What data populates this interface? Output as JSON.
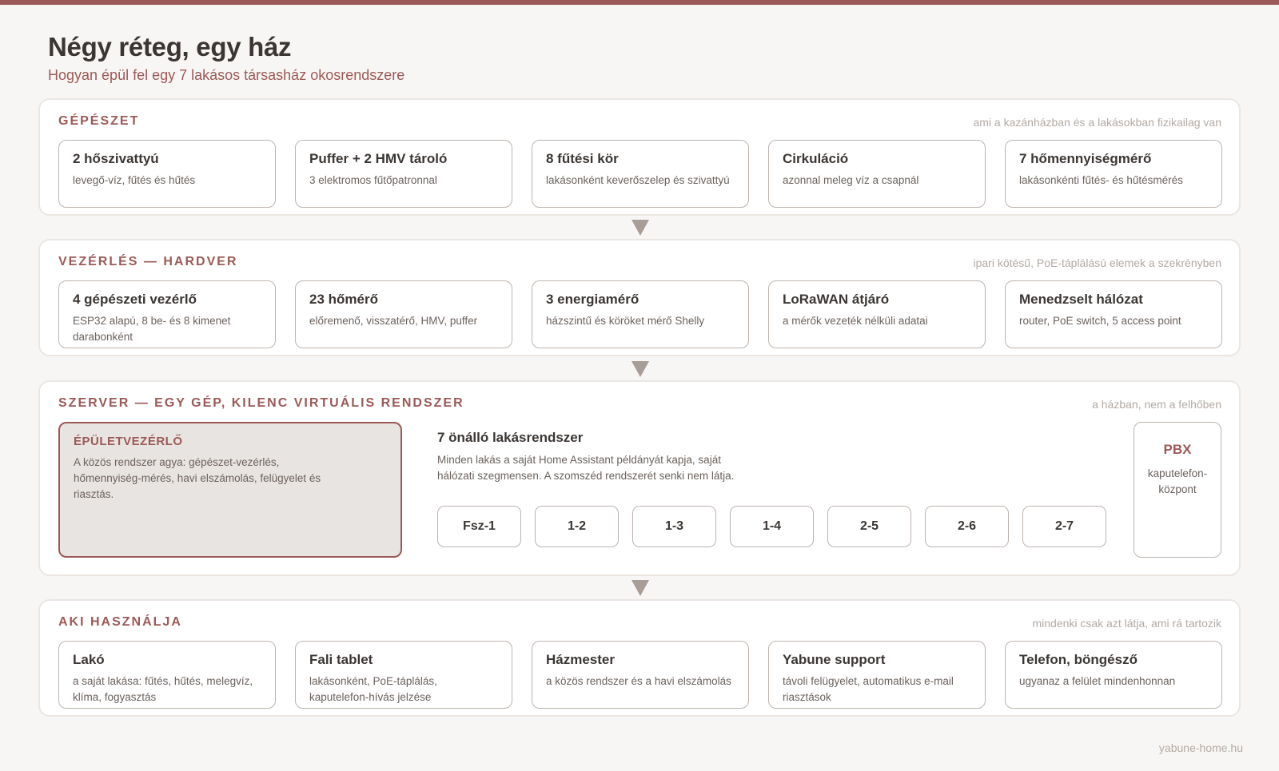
{
  "header": {
    "title": "Négy réteg, egy ház",
    "subtitle": "Hogyan épül fel egy 7 lakásos társasház okosrendszere"
  },
  "layers": [
    {
      "title": "GÉPÉSZET",
      "note": "ami a kazánházban és a lakásokban fizikailag van",
      "cards": [
        {
          "title": "2 hőszivattyú",
          "desc": "levegő-víz, fűtés és hűtés"
        },
        {
          "title": "Puffer + 2 HMV tároló",
          "desc": "3 elektromos fűtőpatronnal"
        },
        {
          "title": "8 fűtési kör",
          "desc": "lakásonként keverőszelep és szivattyú"
        },
        {
          "title": "Cirkuláció",
          "desc": "azonnal meleg víz a csapnál"
        },
        {
          "title": "7 hőmennyiségmérő",
          "desc": "lakásonkénti fűtés- és hűtésmérés"
        }
      ]
    },
    {
      "title": "VEZÉRLÉS — HARDVER",
      "note": "ipari kötésű, PoE-táplálású elemek a szekrényben",
      "cards": [
        {
          "title": "4 gépészeti vezérlő",
          "desc": "ESP32 alapú, 8 be- és 8 kimenet darabonként"
        },
        {
          "title": "23 hőmérő",
          "desc": "előremenő, visszatérő, HMV, puffer"
        },
        {
          "title": "3 energiamérő",
          "desc": "házszintű és köröket mérő Shelly"
        },
        {
          "title": "LoRaWAN átjáró",
          "desc": "a mérők vezeték nélküli adatai"
        },
        {
          "title": "Menedzselt hálózat",
          "desc": "router, PoE switch, 5 access point"
        }
      ]
    },
    {
      "title": "SZERVER — EGY GÉP, KILENC VIRTUÁLIS RENDSZER",
      "note": "a házban, nem a felhőben",
      "building": {
        "title": "ÉPÜLETVEZÉRLŐ",
        "desc": "A közös rendszer agya: gépészet-vezérlés, hőmennyiség-mérés, havi elszámolás, felügyelet és riasztás."
      },
      "apartments": {
        "title": "7 önálló lakásrendszer",
        "desc": "Minden lakás a saját Home Assistant példányát kapja, saját hálózati szegmensen. A szomszéd rendszerét senki nem látja.",
        "units": [
          "Fsz-1",
          "1-2",
          "1-3",
          "1-4",
          "2-5",
          "2-6",
          "2-7"
        ]
      },
      "pbx": {
        "title": "PBX",
        "desc": "kaputelefon-központ"
      }
    },
    {
      "title": "AKI HASZNÁLJA",
      "note": "mindenki csak azt látja, ami rá tartozik",
      "cards": [
        {
          "title": "Lakó",
          "desc": "a saját lakása: fűtés, hűtés, melegvíz, klíma, fogyasztás"
        },
        {
          "title": "Fali tablet",
          "desc": "lakásonként, PoE-táplálás, kaputelefon-hívás jelzése"
        },
        {
          "title": "Házmester",
          "desc": "a közös rendszer és a havi elszámolás"
        },
        {
          "title": "Yabune support",
          "desc": "távoli felügyelet, automatikus e-mail riasztások"
        },
        {
          "title": "Telefon, böngésző",
          "desc": "ugyanaz a felület mindenhonnan"
        }
      ]
    }
  ],
  "footer": "yabune-home.hu"
}
